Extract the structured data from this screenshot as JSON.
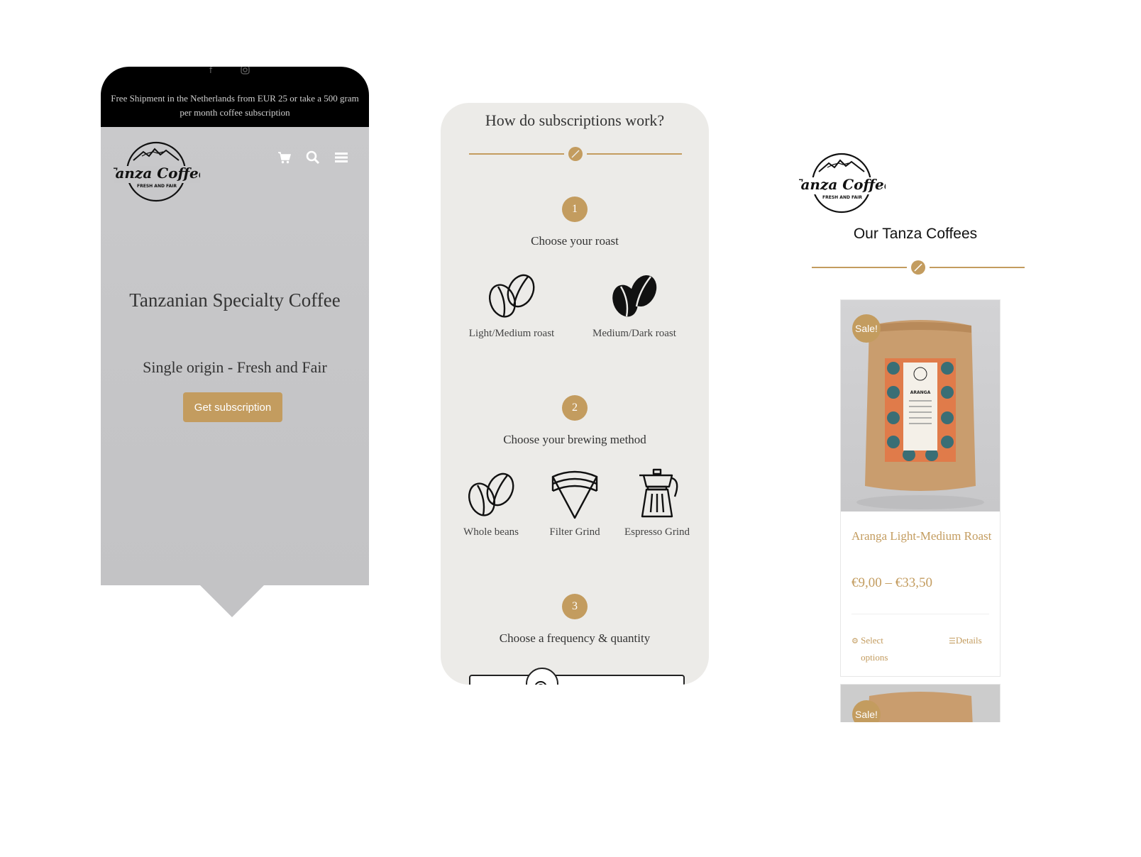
{
  "colors": {
    "accent": "#c39c5f",
    "dark": "#000000",
    "hero_bg": "#c5c5c7",
    "panel_bg": "#ecebe8"
  },
  "screen1": {
    "social_icons": [
      "facebook-icon",
      "instagram-icon"
    ],
    "announcement": "Free Shipment in the Netherlands from EUR 25 or take a 500 gram per month coffee subscription",
    "logo": {
      "brand": "Tanza Coffee",
      "tagline": "FRESH AND FAIR"
    },
    "header_icons": [
      "cart-icon",
      "search-icon",
      "menu-icon"
    ],
    "hero_title": "Tanzanian Specialty Coffee",
    "hero_subtitle": "Single origin - Fresh and Fair",
    "hero_button": "Get subscription"
  },
  "screen2": {
    "title": "How do subscriptions work?",
    "steps": [
      {
        "number": "1",
        "label": "Choose your roast",
        "options": [
          {
            "label": "Light/Medium roast",
            "icon": "coffee-beans-outline-icon"
          },
          {
            "label": "Medium/Dark roast",
            "icon": "coffee-beans-filled-icon"
          }
        ]
      },
      {
        "number": "2",
        "label": "Choose your brewing method",
        "options": [
          {
            "label": "Whole beans",
            "icon": "coffee-beans-outline-icon"
          },
          {
            "label": "Filter Grind",
            "icon": "coffee-filter-icon"
          },
          {
            "label": "Espresso Grind",
            "icon": "moka-pot-icon"
          }
        ]
      },
      {
        "number": "3",
        "label": "Choose a frequency & quantity",
        "options": []
      }
    ]
  },
  "screen3": {
    "logo": {
      "brand": "Tanza Coffee",
      "tagline": "FRESH AND FAIR"
    },
    "section_title": "Our Tanza Coffees",
    "products": [
      {
        "badge": "Sale!",
        "title": "Aranga Light-Medium Roast",
        "price": "€9,00 – €33,50",
        "package_label": "ARANGA",
        "select_options": "Select options",
        "details": "Details"
      },
      {
        "badge": "Sale!"
      }
    ]
  }
}
